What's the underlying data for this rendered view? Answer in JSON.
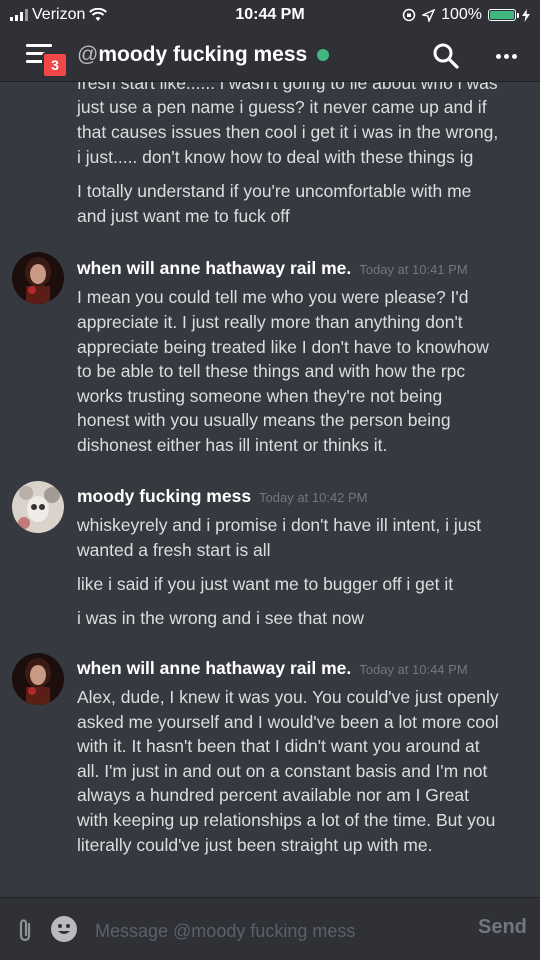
{
  "status_bar": {
    "carrier": "Verizon",
    "time": "10:44 PM",
    "battery": "100%",
    "battery_level": 1.0
  },
  "header": {
    "badge_count": "3",
    "at": "@",
    "title": "moody fucking mess",
    "status_color": "#43b581"
  },
  "messages": {
    "top_continuation": [
      "fresh start like...... i wasn't going to lie about who i was",
      "just use a pen name i guess? it never came up and if",
      "that causes issues then cool i get it i was in the wrong,",
      "i just..... don't know how to deal with these things ig",
      "I totally understand if you're uncomfortable with me",
      "and just want me to fuck off"
    ],
    "group1": {
      "author": "when will anne hathaway rail me.",
      "timestamp": "Today at 10:41 PM",
      "lines": [
        "I mean you could tell me who you were please? I'd",
        "appreciate it. I just really more than anything don't",
        "appreciate being treated like I don't have to knowhow",
        "to be able to tell these things and with how the rpc",
        "works trusting someone when they're not being",
        "honest with you usually means the person being",
        "dishonest either has ill intent or thinks it."
      ]
    },
    "group2": {
      "author": "moody fucking mess",
      "timestamp": "Today at 10:42 PM",
      "lines": [
        "whiskeyrely and i promise i don't have ill intent, i just",
        "wanted a fresh start is all",
        "like i said if you just want me to bugger off i get it",
        "i was in the wrong and i see that now"
      ]
    },
    "group3": {
      "author": "when will anne hathaway rail me.",
      "timestamp": "Today at 10:44 PM",
      "lines": [
        "Alex, dude, I knew it was you. You could've just openly",
        "asked me yourself and I would've been a lot more cool",
        "with it. It hasn't been that I didn't want you around at",
        "all. I'm just in and out on a constant basis and I'm not",
        "always a hundred percent available nor am I Great",
        "with keeping up relationships a lot of the time. But you",
        "literally could've just been straight up with me."
      ]
    }
  },
  "composer": {
    "placeholder": "Message @moody fucking mess",
    "send_label": "Send"
  },
  "icons": {
    "menu": "hamburger-icon",
    "search": "search-icon",
    "more": "more-icon",
    "attach": "paperclip-icon",
    "emoji": "emoji-icon",
    "wifi": "wifi-icon",
    "location": "location-icon",
    "charging": "charging-icon"
  }
}
